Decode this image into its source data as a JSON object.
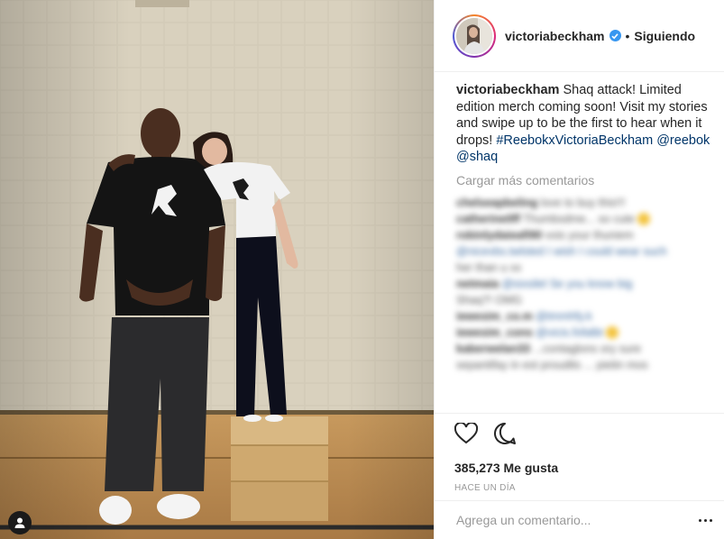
{
  "header": {
    "username": "victoriabeckham",
    "separator": "•",
    "follow_status": "Siguiendo"
  },
  "caption": {
    "username": "victoriabeckham",
    "text": " Shaq attack! Limited edition merch coming soon! Visit my stories and swipe up to be the first to hear when it drops! ",
    "hashtag": "#ReebokxVictoriaBeckham",
    "mention1": "@reebok",
    "mention2": "@shaq"
  },
  "load_more": "Cargar más comentarios",
  "blurred_comments": [
    {
      "user": "chelseapbeling",
      "text": "love to buy this!!!"
    },
    {
      "user": "catherine0ff",
      "text": "Thumbsdme... so cute"
    },
    {
      "user": "robinlydaieafi90",
      "text": "vois your thuniem"
    },
    {
      "user": "",
      "text": "@nicevbs.twlsted I wish I could wear such"
    },
    {
      "user": "",
      "text": "her than u xx"
    },
    {
      "user": "netmaia",
      "text": "@sixsilel Se you know big"
    },
    {
      "user": "",
      "text": "Shaq?! OMG"
    },
    {
      "user": "iewesim_co.m",
      "text": "@tmmhfy.k"
    },
    {
      "user": "iewesim_cons",
      "text": "@vicis.fofalbt"
    },
    {
      "user": "kaberwelan33",
      "text": "...contaglons ory sure"
    },
    {
      "user": "",
      "text": "sepantifay in est proudits ... pietin mos"
    }
  ],
  "actions": {
    "likes": "385,273 Me gusta",
    "time": "HACE UN DÍA"
  },
  "add_comment": {
    "placeholder": "Agrega un comentario..."
  },
  "colors": {
    "link": "#003569",
    "verified": "#3897f0",
    "muted": "#999999"
  },
  "icons": [
    "heart-icon",
    "comment-icon",
    "verified-icon",
    "more-options-icon",
    "user-tag-icon"
  ]
}
